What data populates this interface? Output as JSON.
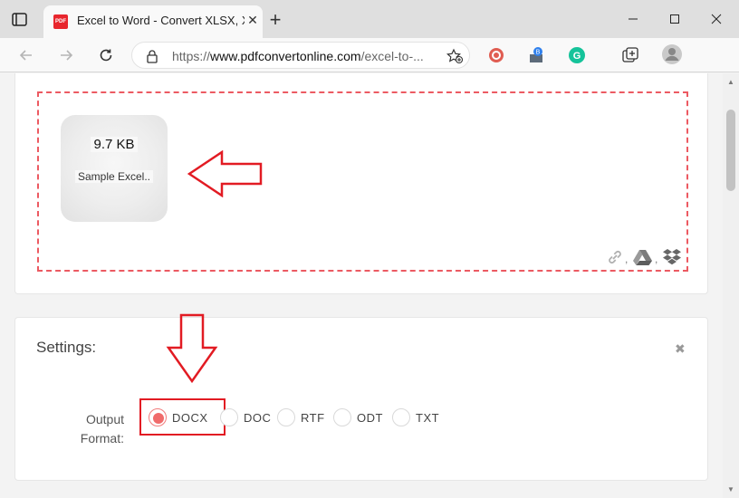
{
  "browser": {
    "tab_title": "Excel to Word - Convert XLSX, XLS",
    "favicon_text": "PDF",
    "new_tab": "+",
    "tab_close": "✕",
    "url_prefix": "https://",
    "url_domain": "www.pdfconvertonline.com",
    "url_path": "/excel-to-...",
    "icons": [
      "tab-actions-icon",
      "back-icon",
      "forward-icon",
      "refresh-icon",
      "lock-icon",
      "favorite-add-icon",
      "extension-red-icon",
      "extension-badge-icon",
      "grammarly-icon",
      "collections-icon",
      "profile-icon",
      "minimize-icon",
      "maximize-icon",
      "close-icon"
    ]
  },
  "upload": {
    "file_size": "9.7 KB",
    "file_name": "Sample Excel..",
    "sources": [
      "link-icon",
      "google-drive-icon",
      "dropbox-icon"
    ],
    "separator": ","
  },
  "settings": {
    "title": "Settings:",
    "close": "✖",
    "output_label": "Output Format:",
    "formats": [
      {
        "label": "DOCX",
        "selected": true
      },
      {
        "label": "DOC",
        "selected": false
      },
      {
        "label": "RTF",
        "selected": false
      },
      {
        "label": "ODT",
        "selected": false
      },
      {
        "label": "TXT",
        "selected": false
      }
    ]
  },
  "colors": {
    "accent_red": "#e21b23",
    "dashed_border": "#ec5a62",
    "radio_selected": "#f06b6b"
  }
}
